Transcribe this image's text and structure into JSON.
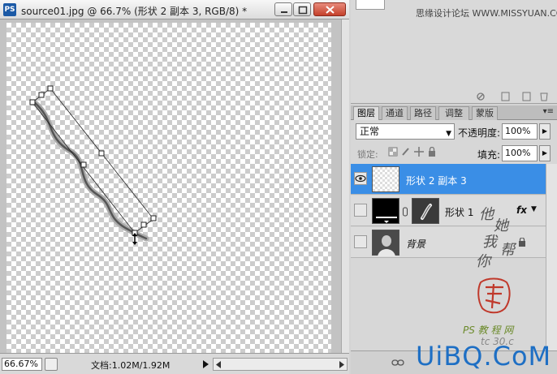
{
  "document": {
    "title": "source01.jpg @ 66.7% (形状 2 副本 3, RGB/8) *",
    "app_icon": "PS",
    "zoom": "66.67%",
    "doc_size": "文档:1.02M/1.92M"
  },
  "watermarks": {
    "top_text": "思缘设计论坛 WWW.MISSYUAN.COM",
    "brand": "UiBQ.CoM",
    "ps_text": "PS 教 程 网",
    "url_text": "tc 30.c",
    "calligraphy": [
      "他",
      "她",
      "我",
      "你",
      "帮"
    ]
  },
  "layers_panel": {
    "tabs": [
      "图层",
      "通道",
      "路径",
      "调整",
      "蒙版"
    ],
    "active_tab": 0,
    "blend_mode": "正常",
    "opacity_label": "不透明度:",
    "opacity_value": "100%",
    "lock_label": "锁定:",
    "fill_label": "填充:",
    "fill_value": "100%",
    "layers": [
      {
        "name": "形状 2 副本 3",
        "selected": true,
        "visible": true
      },
      {
        "name": "形状 1",
        "selected": false,
        "visible": false,
        "fx": "fx"
      },
      {
        "name": "背景",
        "selected": false,
        "visible": false,
        "locked": true
      }
    ]
  },
  "colors": {
    "selected_layer": "#3a8ee6",
    "brand": "#1e6fc4"
  }
}
